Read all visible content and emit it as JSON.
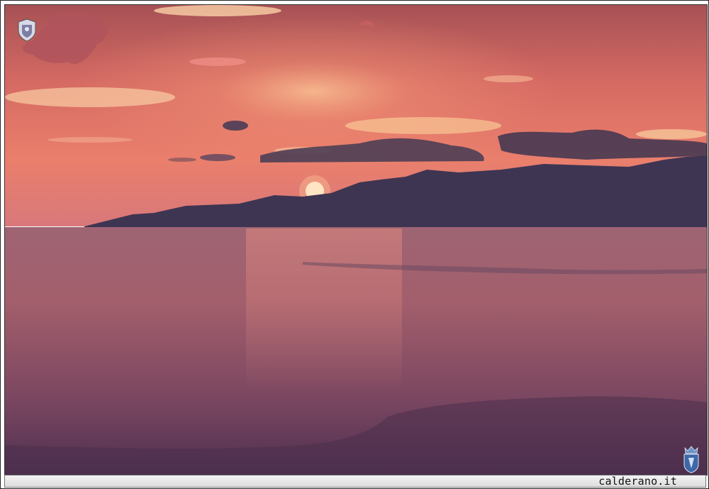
{
  "photo": {
    "subject": "sunset",
    "colors": {
      "sky_top": "#b85a58",
      "sky_mid": "#e8766a",
      "horizon_glow": "#f59a7a",
      "sun": "#ffe6c8",
      "mountains": "#3d3550",
      "sea_top": "#a06070",
      "sea_bottom": "#5a3550"
    }
  },
  "watermark": {
    "signature_text": ""
  },
  "footer": {
    "site_label": "calderano.it"
  }
}
